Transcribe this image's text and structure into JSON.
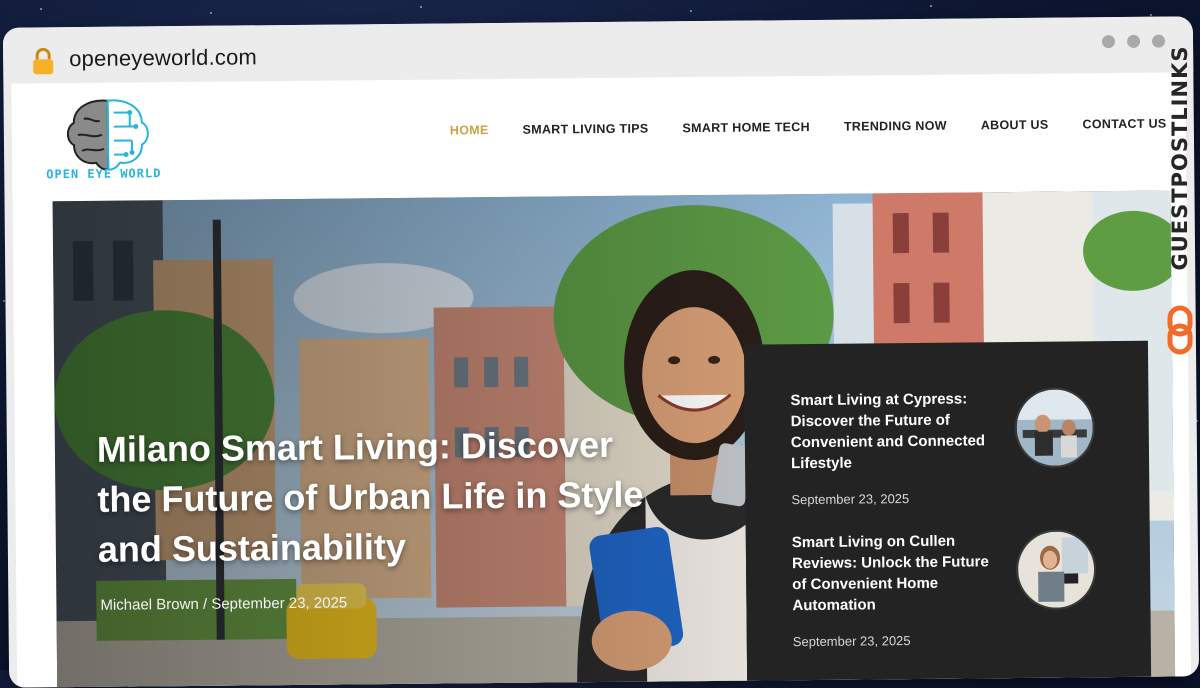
{
  "browser": {
    "url": "openeyeworld.com"
  },
  "site": {
    "logo_text": "OPEN EYE WORLD",
    "nav": [
      {
        "label": "HOME",
        "active": true
      },
      {
        "label": "SMART LIVING TIPS",
        "active": false
      },
      {
        "label": "SMART HOME TECH",
        "active": false
      },
      {
        "label": "TRENDING NOW",
        "active": false
      },
      {
        "label": "ABOUT US",
        "active": false
      },
      {
        "label": "CONTACT US",
        "active": false
      }
    ]
  },
  "hero": {
    "title": "Milano Smart Living: Discover the Future of Urban Life in Style and Sustainability",
    "author": "Michael Brown",
    "separator": "/",
    "date": "September 23, 2025"
  },
  "sidebar_posts": [
    {
      "title": "Smart Living at Cypress: Discover the Future of Convenient and Connected Lifestyle",
      "date": "September 23, 2025",
      "thumb_icon": "gym-photo-thumbnail"
    },
    {
      "title": "Smart Living on Cullen Reviews: Unlock the Future of Convenient Home Automation",
      "date": "September 23, 2025",
      "thumb_icon": "woman-tablet-photo-thumbnail"
    }
  ],
  "watermark": {
    "text": "GUESTPOSTLINKS",
    "icon": "link-chain-icon",
    "accent": "#f26b2a"
  },
  "colors": {
    "nav_active": "#c9a24a",
    "logo_accent": "#27b6d8",
    "panel_bg": "#232323"
  }
}
